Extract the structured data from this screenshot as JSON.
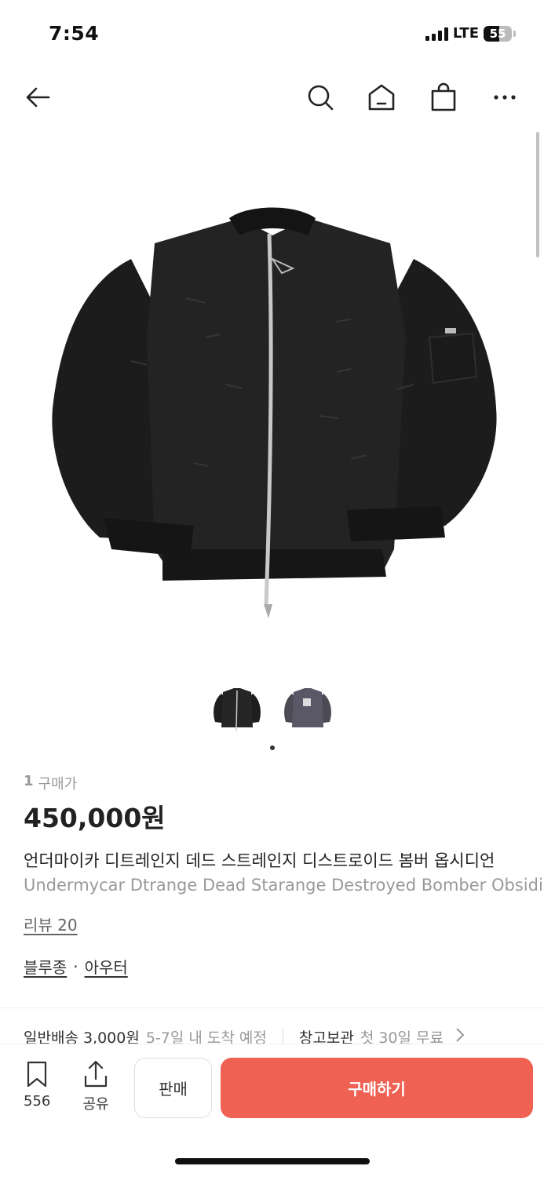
{
  "status": {
    "time": "7:54",
    "network": "LTE",
    "battery": "55",
    "battery_level_percent": 55
  },
  "nav": {
    "back_icon": "arrow-left-icon",
    "search_icon": "search-icon",
    "home_icon": "home-icon",
    "cart_icon": "shopping-bag-icon",
    "more_icon": "more-horizontal-icon"
  },
  "product": {
    "purchase_count_num": "1",
    "purchase_count_label": "구매가",
    "price": "450,000원",
    "title_ko": "언더마이카 디트레인지 데드 스트레인지 디스트로이드 봄버 옵시디언",
    "title_en": "Undermycar Dtrange Dead Starange Destroyed Bomber Obsidian",
    "review_link": "리뷰 20",
    "category_1": "블루종",
    "category_sep": "·",
    "category_2": "아우터",
    "image_count": 2,
    "active_image_index": 1
  },
  "shipping": {
    "normal_label": "일반배송 3,000원",
    "normal_eta": "5-7일 내 도착 예정",
    "storage_label": "창고보관",
    "storage_detail": "첫 30일 무료"
  },
  "bottom": {
    "bookmark_count": "556",
    "share_label": "공유",
    "sell_label": "판매",
    "buy_label": "구매하기",
    "accent_color": "#ef6253"
  }
}
